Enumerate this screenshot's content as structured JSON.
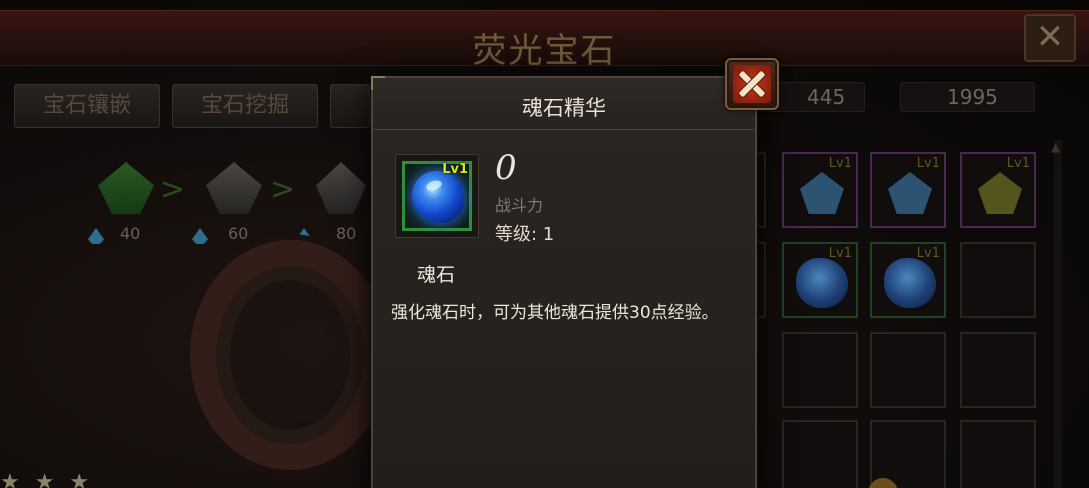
{
  "background": {
    "title": "荧光宝石",
    "tabs": [
      "宝石镶嵌",
      "宝石挖掘"
    ],
    "currencies": [
      {
        "icon": "blue-gem-icon",
        "value": "445"
      },
      {
        "icon": "blue-gem-icon",
        "value": "1995"
      }
    ],
    "upgrade_chain": [
      {
        "icon": "green-gem-icon",
        "cost": "40"
      },
      {
        "icon": "grey-gem-icon",
        "cost": "60"
      },
      {
        "icon": "grey-gem-icon",
        "cost": "80"
      }
    ],
    "slot_level_badge": "Lv1",
    "close_icon": "close-icon"
  },
  "dialog": {
    "title": "魂石精华",
    "item": {
      "icon": "blue-soulstone-icon",
      "level_badge": "Lv1",
      "power_value": "0",
      "power_label": "战斗力",
      "level_text": "等级: 1",
      "name": "魂石",
      "description": "强化魂石时，可为其他魂石提供30点经验。"
    },
    "close_icon": "close-icon"
  },
  "colors": {
    "accent_red": "#c0391c",
    "frame_green": "#2f8f3a",
    "level_yellow": "#d9e31f"
  }
}
